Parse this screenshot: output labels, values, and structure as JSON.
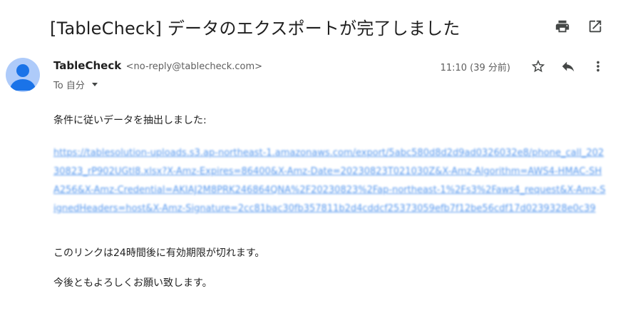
{
  "email": {
    "subject": "[TableCheck] データのエクスポートが完了しました",
    "sender_name": "TableCheck",
    "sender_email": "<no-reply@tablecheck.com>",
    "recipient": "To 自分",
    "time": "11:10 (39 分前)",
    "body_line1": "条件に従いデータを抽出しました:",
    "link_text": "https://tablesolution-uploads.s3.ap-northeast-1.amazonaws.com/export/5abc580d8d2d9ad0326032e8/phone_call_20230823_rP902UGtl8.xlsx?X-Amz-Expires=86400&X-Amz-Date=20230823T021030Z&X-Amz-Algorithm=AWS4-HMAC-SHA256&X-Amz-Credential=AKIAJ2M8PRK246864QNA%2F20230823%2Fap-northeast-1%2Fs3%2Faws4_request&X-Amz-SignedHeaders=host&X-Amz-Signature=2cc81bac30fb357811b2d4cddcf25373059efb7f12be56cdf17d0239328e0c39",
    "body_line2": "このリンクは24時間後に有効期限が切れます。",
    "body_line3": "今後ともよろしくお願い致します。"
  },
  "icons": {
    "print": "print-icon",
    "open_new": "open-in-new-icon",
    "star": "star-icon",
    "reply": "reply-icon",
    "more": "more-vert-icon",
    "avatar": "avatar-icon"
  },
  "colors": {
    "link": "#1a73e8",
    "avatar_bg": "#aecbfa",
    "avatar_fg": "#1a73e8"
  }
}
